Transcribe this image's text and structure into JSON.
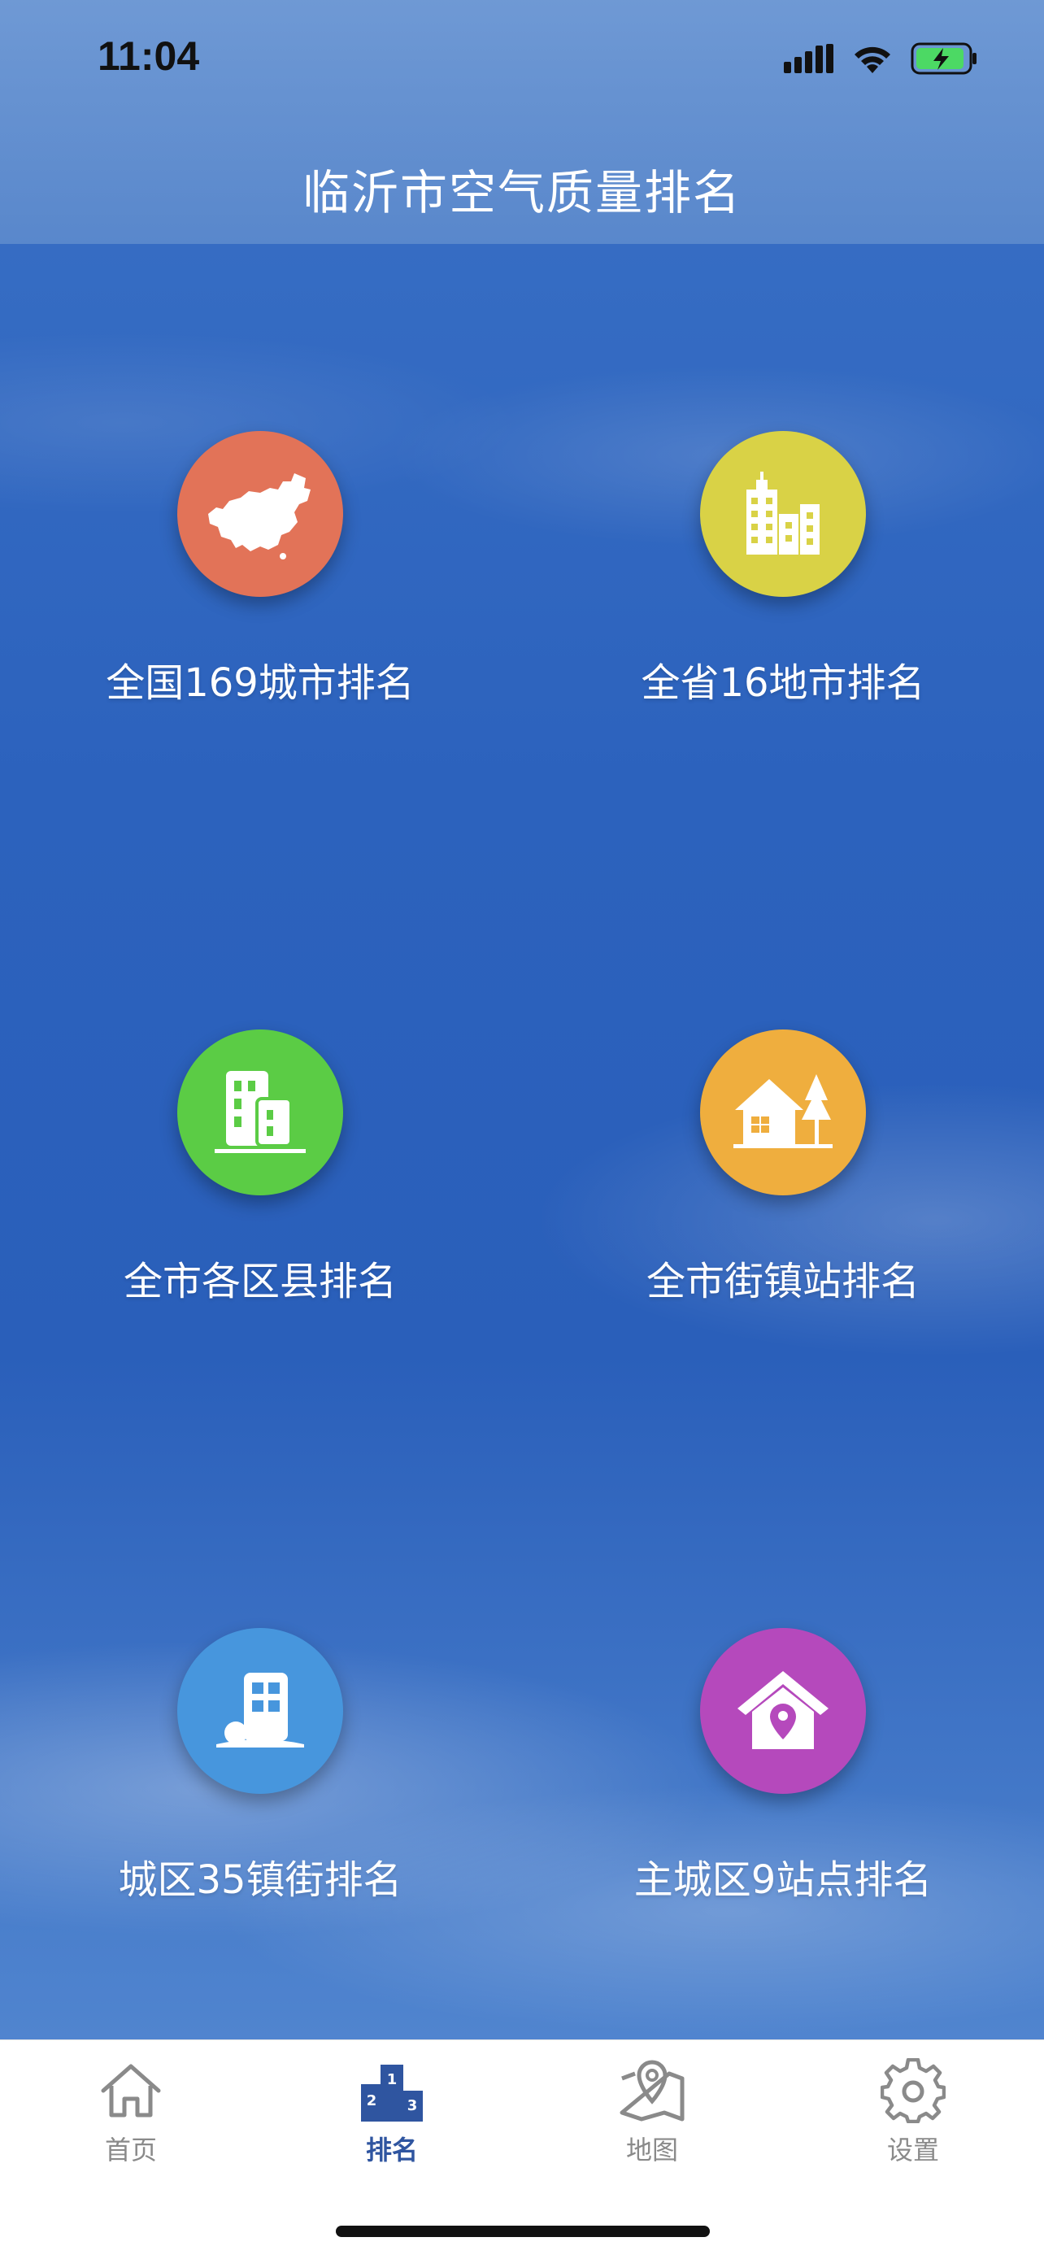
{
  "status_bar": {
    "time": "11:04"
  },
  "header": {
    "title": "临沂市空气质量排名"
  },
  "tiles": [
    {
      "label": "全国169城市排名",
      "icon": "china-map-icon",
      "color": "#E27358"
    },
    {
      "label": "全省16地市排名",
      "icon": "city-buildings-icon",
      "color": "#D9D246"
    },
    {
      "label": "全市各区县排名",
      "icon": "office-buildings-icon",
      "color": "#5BCC45"
    },
    {
      "label": "全市街镇站排名",
      "icon": "town-house-tree-icon",
      "color": "#EFAE3E"
    },
    {
      "label": "城区35镇街排名",
      "icon": "urban-building-icon",
      "color": "#4796DD"
    },
    {
      "label": "主城区9站点排名",
      "icon": "house-location-icon",
      "color": "#B549BC"
    }
  ],
  "tabbar": {
    "active_color": "#2F55A0",
    "inactive_color": "#8A8A8A",
    "items": [
      {
        "label": "首页",
        "icon": "home-icon",
        "active": false
      },
      {
        "label": "排名",
        "icon": "podium-icon",
        "active": true
      },
      {
        "label": "地图",
        "icon": "map-pin-icon",
        "active": false
      },
      {
        "label": "设置",
        "icon": "gear-icon",
        "active": false
      }
    ]
  }
}
